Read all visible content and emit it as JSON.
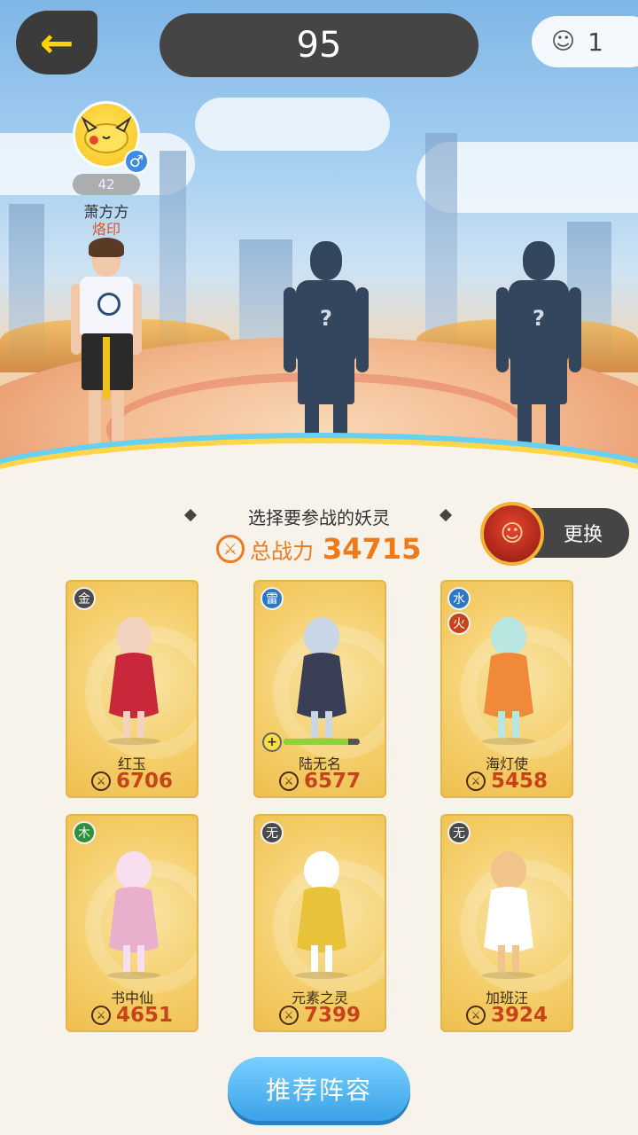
{
  "topbar": {
    "score": "95",
    "player_count": "1"
  },
  "player": {
    "level": "42",
    "name": "萧方方",
    "tag": "烙印"
  },
  "selection": {
    "prompt": "选择要参战的妖灵",
    "total_power_label": "总战力",
    "total_power": "34715",
    "swap_label": "更换"
  },
  "cards": [
    {
      "name": "红玉",
      "power": "6706",
      "elements": [
        "金"
      ],
      "elem_colors": [
        "#4a4a4a"
      ]
    },
    {
      "name": "陆无名",
      "power": "6577",
      "elements": [
        "雷"
      ],
      "elem_colors": [
        "#2b78c8"
      ],
      "hp_fraction": 0.85
    },
    {
      "name": "海灯使",
      "power": "5458",
      "elements": [
        "水",
        "火"
      ],
      "elem_colors": [
        "#2b78c8",
        "#c8421a"
      ]
    },
    {
      "name": "书中仙",
      "power": "4651",
      "elements": [
        "木"
      ],
      "elem_colors": [
        "#2f8f3a"
      ]
    },
    {
      "name": "元素之灵",
      "power": "7399",
      "elements": [
        "无"
      ],
      "elem_colors": [
        "#4a4a4a"
      ]
    },
    {
      "name": "加班汪",
      "power": "3924",
      "elements": [
        "无"
      ],
      "elem_colors": [
        "#4a4a4a"
      ]
    }
  ],
  "bottom": {
    "recommend_label": "推荐阵容"
  },
  "colors": {
    "accent_orange": "#f07a1a",
    "button_blue": "#3aa2e8",
    "card_gold": "#f5cf6c"
  },
  "icons": {
    "back": "back-arrow-icon",
    "players": "players-icon",
    "power": "sword-icon",
    "gender": "male-icon"
  }
}
